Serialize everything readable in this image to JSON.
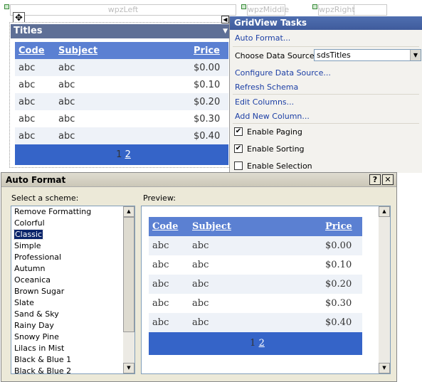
{
  "zones": {
    "left": "wpzLeft",
    "middle": "wpzMiddle",
    "right": "wpzRight"
  },
  "webpart": {
    "title": "Titles",
    "columns": [
      "Code",
      "Subject",
      "Price"
    ],
    "rows": [
      [
        "abc",
        "abc",
        "$0.00"
      ],
      [
        "abc",
        "abc",
        "$0.10"
      ],
      [
        "abc",
        "abc",
        "$0.20"
      ],
      [
        "abc",
        "abc",
        "$0.30"
      ],
      [
        "abc",
        "abc",
        "$0.40"
      ]
    ],
    "pager": {
      "current": "1",
      "next": "2"
    }
  },
  "tasks": {
    "title": "GridView Tasks",
    "auto_format": "Auto Format...",
    "choose_ds_label": "Choose Data Source:",
    "ds_value": "sdsTitles",
    "configure_ds": "Configure Data Source...",
    "refresh_schema": "Refresh Schema",
    "edit_columns": "Edit Columns...",
    "add_column": "Add New Column...",
    "enable_paging": {
      "label": "Enable Paging",
      "checked": true
    },
    "enable_sorting": {
      "label": "Enable Sorting",
      "checked": true
    },
    "enable_selection": {
      "label": "Enable Selection",
      "checked": false
    }
  },
  "dialog": {
    "title": "Auto Format",
    "help": "?",
    "close": "✕",
    "scheme_label": "Select a scheme:",
    "preview_label": "Preview:",
    "schemes": [
      "Remove Formatting",
      "Colorful",
      "Classic",
      "Simple",
      "Professional",
      "Autumn",
      "Oceanica",
      "Brown Sugar",
      "Slate",
      "Sand & Sky",
      "Rainy Day",
      "Snowy Pine",
      "Lilacs in Mist",
      "Black & Blue 1",
      "Black & Blue 2"
    ],
    "selected_scheme": "Classic"
  },
  "colors": {
    "header": "#5b80d2",
    "pager": "#3564c8",
    "title_bar": "#5e6f96"
  }
}
